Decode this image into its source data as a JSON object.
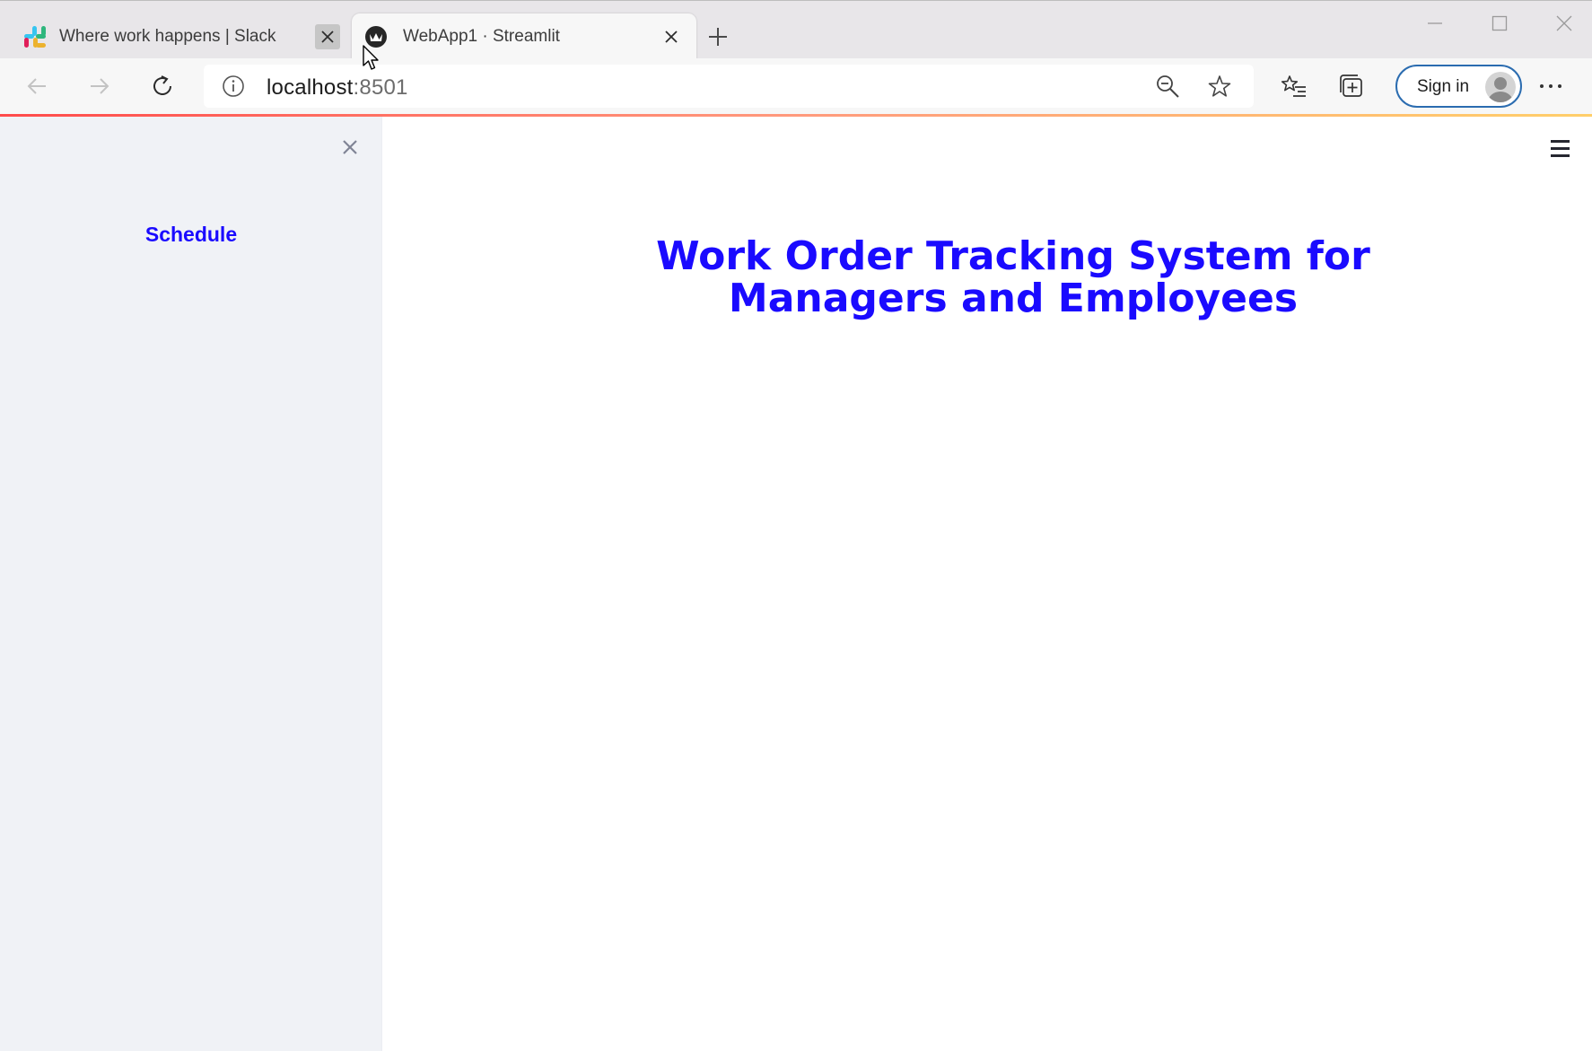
{
  "browser": {
    "tabs": [
      {
        "title": "Where work happens | Slack",
        "active": false,
        "icon": "slack-icon"
      },
      {
        "title": "WebApp1 · Streamlit",
        "active": true,
        "icon": "streamlit-icon"
      }
    ],
    "address": {
      "host": "localhost",
      "port": ":8501"
    },
    "signin_label": "Sign in"
  },
  "sidebar": {
    "items": [
      {
        "label": "Schedule"
      }
    ]
  },
  "main": {
    "title_line1": "Work Order Tracking System for",
    "title_line2": "Managers and Employees"
  },
  "colors": {
    "accent": "#1a0aff",
    "sidebar_bg": "#f0f2f6",
    "signin_border": "#2b6cb0"
  }
}
